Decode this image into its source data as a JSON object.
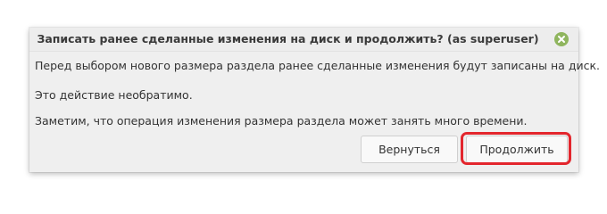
{
  "dialog": {
    "title": "Записать ранее сделанные изменения на диск и продолжить? (as superuser)",
    "close_icon": "close-icon",
    "messages": [
      "Перед выбором нового размера раздела ранее сделанные изменения будут записаны на диск.",
      "Это действие необратимо.",
      "Заметим, что операция изменения размера раздела может занять много времени."
    ],
    "buttons": {
      "back_label": "Вернуться",
      "continue_label": "Продолжить"
    }
  },
  "colors": {
    "close_button": "#8fb55e",
    "highlight": "#e3262d"
  }
}
